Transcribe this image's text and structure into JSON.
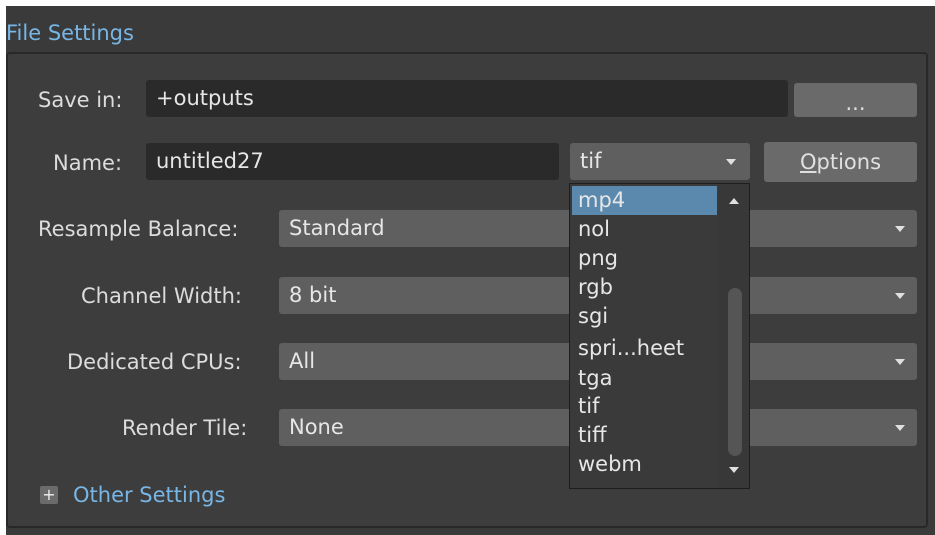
{
  "section_title": "File Settings",
  "save_in": {
    "label": "Save in:",
    "value": "+outputs",
    "browse_label": "..."
  },
  "name": {
    "label": "Name:",
    "value": "untitled27",
    "format": "tif",
    "options_label_first": "O",
    "options_label_rest": "ptions"
  },
  "resample_balance": {
    "label": "Resample Balance:",
    "value": "Standard"
  },
  "channel_width": {
    "label": "Channel Width:",
    "value": "8 bit"
  },
  "dedicated_cpus": {
    "label": "Dedicated CPUs:",
    "value": "All"
  },
  "render_tile": {
    "label": "Render Tile:",
    "value": "None"
  },
  "format_dropdown": {
    "items": [
      "mp4",
      "nol",
      "png",
      "rgb",
      "sgi",
      "spri...heet",
      "tga",
      "tif",
      "tiff",
      "webm"
    ],
    "selected": "mp4"
  },
  "other_settings": {
    "expand_glyph": "+",
    "label": "Other Settings"
  },
  "colors": {
    "accent": "#78b6e6",
    "selection": "#5b88ad",
    "panel": "#3a3a3a"
  }
}
